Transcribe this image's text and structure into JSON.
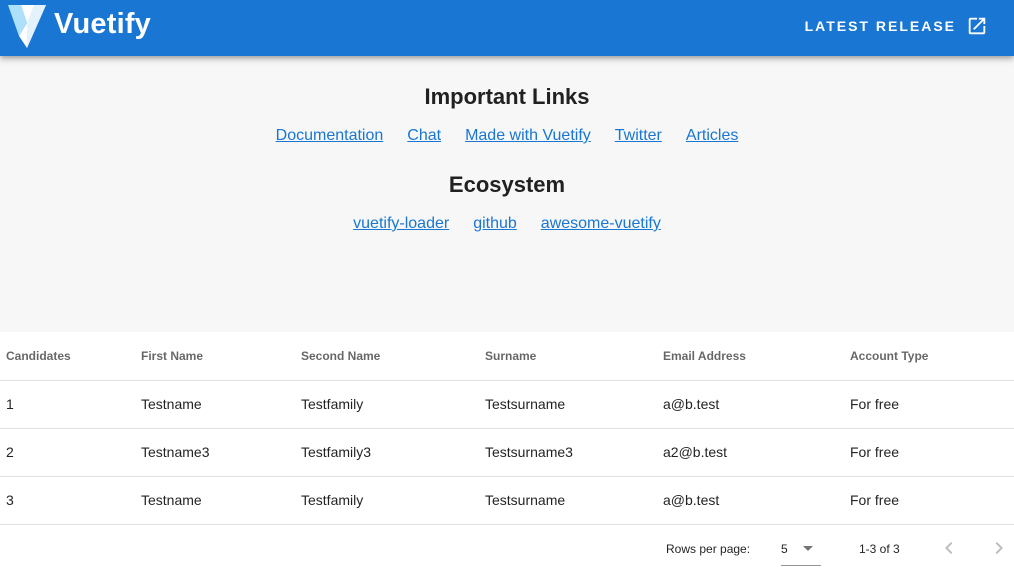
{
  "app_bar": {
    "brand": "Vuetify",
    "release_label": "Latest Release",
    "release_icon": "open-in-new-icon",
    "color": "#1976d2"
  },
  "important_links": {
    "title": "Important Links",
    "items": [
      "Documentation",
      "Chat",
      "Made with Vuetify",
      "Twitter",
      "Articles"
    ]
  },
  "ecosystem": {
    "title": "Ecosystem",
    "items": [
      "vuetify-loader",
      "github",
      "awesome-vuetify"
    ]
  },
  "table": {
    "headers": [
      "Candidates",
      "First Name",
      "Second Name",
      "Surname",
      "Email Address",
      "Account Type"
    ],
    "rows": [
      [
        "1",
        "Testname",
        "Testfamily",
        "Testsurname",
        "a@b.test",
        "For free"
      ],
      [
        "2",
        "Testname3",
        "Testfamily3",
        "Testsurname3",
        "a2@b.test",
        "For free"
      ],
      [
        "3",
        "Testname",
        "Testfamily",
        "Testsurname",
        "a@b.test",
        "For free"
      ]
    ]
  },
  "pagination": {
    "rows_per_page_label": "Rows per page:",
    "rows_per_page_value": "5",
    "range_text": "1-3 of 3",
    "prev_icon": "chevron-left-icon",
    "next_icon": "chevron-right-icon"
  }
}
